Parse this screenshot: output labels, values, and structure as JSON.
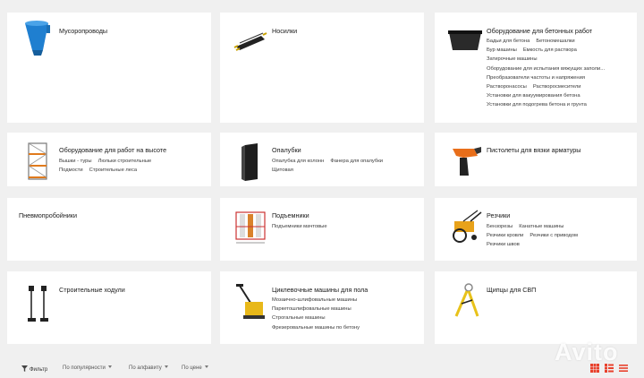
{
  "categories": [
    {
      "title": "Мусоропроводы",
      "subs": []
    },
    {
      "title": "Носилки",
      "subs": []
    },
    {
      "title": "Оборудование для бетонных работ",
      "subs": [
        [
          "Бадьи для бетона",
          "Бетономешалки"
        ],
        [
          "Бур машины",
          "Емкость для раствора"
        ],
        [
          "Затирочные машины"
        ],
        [
          "Оборудование для испытания вяжущих заполи..."
        ],
        [
          "Преобразователи частоты и напряжения"
        ],
        [
          "Растворонасосы",
          "Растворосмесители"
        ],
        [
          "Установки для вакуумирования бетона"
        ],
        [
          "Установки для подогрева бетона и грунта"
        ]
      ]
    },
    {
      "title": "Оборудование для работ на высоте",
      "subs": [
        [
          "Вышки - туры",
          "Люльки строительные"
        ],
        [
          "Подмости",
          "Строительные леса"
        ]
      ]
    },
    {
      "title": "Опалубки",
      "subs": [
        [
          "Опалубка для колонн",
          "Фанера для опалубки"
        ],
        [
          "Щитовая"
        ]
      ]
    },
    {
      "title": "Пистолеты для вязки арматуры",
      "subs": []
    },
    {
      "title": "Пневмопробойники",
      "subs": []
    },
    {
      "title": "Подъемники",
      "subs": [
        [
          "Подъемники мачтовые"
        ]
      ]
    },
    {
      "title": "Резчики",
      "subs": [
        [
          "Бензорезы",
          "Канатные машины"
        ],
        [
          "Резчики кровли",
          "Резчики с приводом"
        ],
        [
          "Резчики швов"
        ]
      ]
    },
    {
      "title": "Строительные ходули",
      "subs": []
    },
    {
      "title": "Циклевочные машины для пола",
      "subs": [
        [
          "Мозаично-шлифовальные машины"
        ],
        [
          "Паркетошлифовальные машины"
        ],
        [
          "Строгальные машины"
        ],
        [
          "Фрезеровальные машины по бетону"
        ]
      ]
    },
    {
      "title": "Щипцы для СВП",
      "subs": []
    }
  ],
  "toolbar": {
    "filter_label": "Фильтр",
    "sort_popularity": "По популярности",
    "sort_alpha": "По алфавиту",
    "sort_price": "По цене"
  },
  "watermark": "Avito",
  "icons": [
    "chute-icon",
    "stretcher-icon",
    "concrete-tub-icon",
    "scaffold-tower-icon",
    "formwork-panel-icon",
    "rebar-tying-gun-icon",
    "lift-icon",
    "cutter-icon",
    "stilts-icon",
    "floor-sander-icon",
    "svp-pliers-icon",
    "filter-icon",
    "grid-view-icon",
    "list-view-icon",
    "compact-list-icon"
  ],
  "colors": {
    "accent": "#e8412c",
    "background": "#f0f0f0",
    "card": "#ffffff"
  }
}
